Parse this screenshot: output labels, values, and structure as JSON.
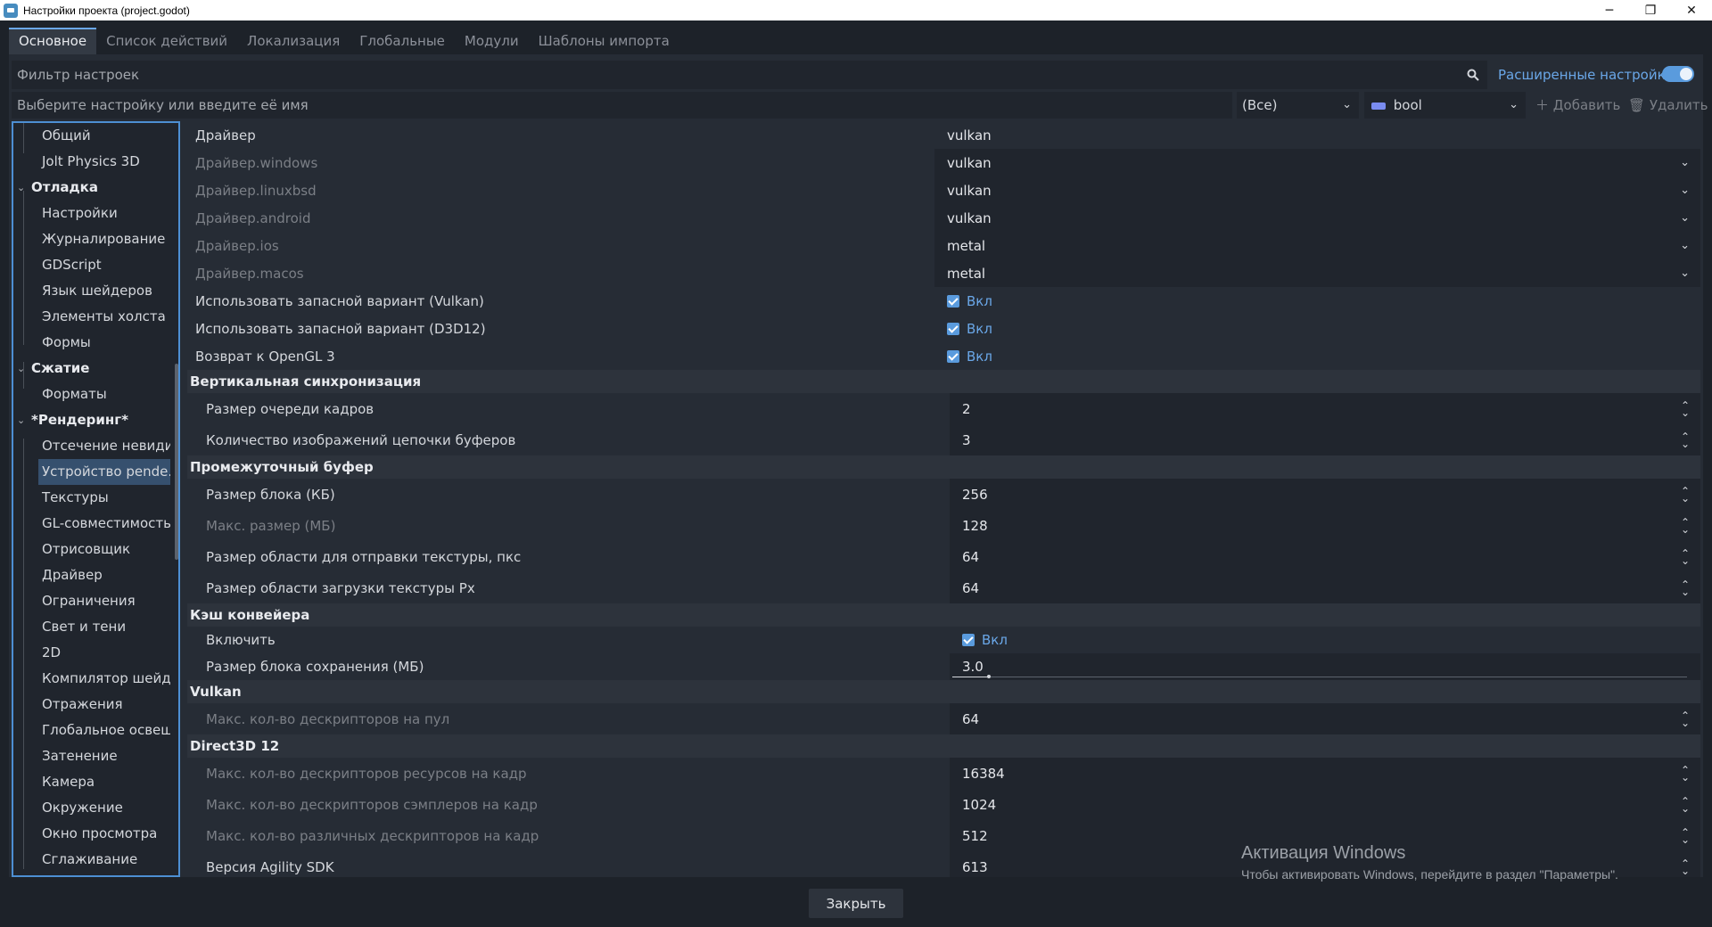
{
  "window": {
    "title": "Настройки проекта (project.godot)",
    "minimize": "─",
    "maximize": "❐",
    "close": "✕"
  },
  "tabs": [
    {
      "label": "Основное",
      "active": true
    },
    {
      "label": "Список действий"
    },
    {
      "label": "Локализация"
    },
    {
      "label": "Глобальные"
    },
    {
      "label": "Модули"
    },
    {
      "label": "Шаблоны импорта"
    }
  ],
  "filter": {
    "placeholder": "Фильтр настроек",
    "advanced_label": "Расширенные настройки",
    "advanced_on": true
  },
  "add_row": {
    "name_placeholder": "Выберите настройку или введите её имя",
    "type_filter": "(Все)",
    "value_type": "bool",
    "add_label": "Добавить",
    "delete_label": "Удалить"
  },
  "tree": [
    {
      "label": "Общий",
      "kind": "child"
    },
    {
      "label": "Jolt Physics 3D",
      "kind": "child"
    },
    {
      "label": "Отладка",
      "kind": "group"
    },
    {
      "label": "Настройки",
      "kind": "child"
    },
    {
      "label": "Журналирование ...",
      "kind": "child"
    },
    {
      "label": "GDScript",
      "kind": "child"
    },
    {
      "label": "Язык шейдеров",
      "kind": "child"
    },
    {
      "label": "Элементы холста",
      "kind": "child"
    },
    {
      "label": "Формы",
      "kind": "child"
    },
    {
      "label": "Сжатие",
      "kind": "group"
    },
    {
      "label": "Форматы",
      "kind": "child"
    },
    {
      "label": "*Рендеринг*",
      "kind": "group"
    },
    {
      "label": "Отсечение невиди...",
      "kind": "child"
    },
    {
      "label": "Устройство рende...",
      "kind": "child",
      "selected": true
    },
    {
      "label": "Текстуры",
      "kind": "child"
    },
    {
      "label": "GL-совместимость",
      "kind": "child"
    },
    {
      "label": "Отрисовщик",
      "kind": "child"
    },
    {
      "label": "Драйвер",
      "kind": "child"
    },
    {
      "label": "Ограничения",
      "kind": "child"
    },
    {
      "label": "Свет и тени",
      "kind": "child"
    },
    {
      "label": "2D",
      "kind": "child"
    },
    {
      "label": "Компилятор шейд...",
      "kind": "child"
    },
    {
      "label": "Отражения",
      "kind": "child"
    },
    {
      "label": "Глобальное освещ...",
      "kind": "child"
    },
    {
      "label": "Затенение",
      "kind": "child"
    },
    {
      "label": "Камера",
      "kind": "child"
    },
    {
      "label": "Окружение",
      "kind": "child"
    },
    {
      "label": "Окно просмотра",
      "kind": "child"
    },
    {
      "label": "Сглаживание",
      "kind": "child"
    }
  ],
  "settings": {
    "driver": {
      "rows": [
        {
          "label": "Драйвер",
          "value": "vulkan",
          "dim": false,
          "control": "text"
        },
        {
          "label": "Драйвер.windows",
          "value": "vulkan",
          "dim": true,
          "control": "dropdown"
        },
        {
          "label": "Драйвер.linuxbsd",
          "value": "vulkan",
          "dim": true,
          "control": "dropdown"
        },
        {
          "label": "Драйвер.android",
          "value": "vulkan",
          "dim": true,
          "control": "dropdown"
        },
        {
          "label": "Драйвер.ios",
          "value": "metal",
          "dim": true,
          "control": "dropdown"
        },
        {
          "label": "Драйвер.macos",
          "value": "metal",
          "dim": true,
          "control": "dropdown"
        },
        {
          "label": "Использовать запасной вариант (Vulkan)",
          "value": "Вкл",
          "dim": false,
          "control": "checkbox"
        },
        {
          "label": "Использовать запасной вариант (D3D12)",
          "value": "Вкл",
          "dim": false,
          "control": "checkbox"
        },
        {
          "label": "Возврат к OpenGL 3",
          "value": "Вкл",
          "dim": false,
          "control": "checkbox"
        }
      ]
    },
    "sections": [
      {
        "title": "Вертикальная синхронизация",
        "rows": [
          {
            "label": "Размер очереди кадров",
            "value": "2",
            "dim": false,
            "control": "spin"
          },
          {
            "label": "Количество изображений цепочки буферов",
            "value": "3",
            "dim": false,
            "control": "spin"
          }
        ]
      },
      {
        "title": "Промежуточный буфер",
        "rows": [
          {
            "label": "Размер блока (КБ)",
            "value": "256",
            "dim": false,
            "control": "spin"
          },
          {
            "label": "Макс. размер (МБ)",
            "value": "128",
            "dim": true,
            "control": "spin"
          },
          {
            "label": "Размер области для отправки текстуры, пкс",
            "value": "64",
            "dim": false,
            "control": "spin"
          },
          {
            "label": "Размер области загрузки текстуры Px",
            "value": "64",
            "dim": false,
            "control": "spin"
          }
        ]
      },
      {
        "title": "Кэш конвейера",
        "rows": [
          {
            "label": "Включить",
            "value": "Вкл",
            "dim": false,
            "control": "checkbox"
          },
          {
            "label": "Размер блока сохранения (МБ)",
            "value": "3.0",
            "dim": false,
            "control": "slider",
            "level": 0.05
          }
        ]
      },
      {
        "title": "Vulkan",
        "rows": [
          {
            "label": "Макс. кол-во дескрипторов на пул",
            "value": "64",
            "dim": true,
            "control": "spin"
          }
        ]
      },
      {
        "title": "Direct3D 12",
        "rows": [
          {
            "label": "Макс. кол-во дескрипторов ресурсов на кадр",
            "value": "16384",
            "dim": true,
            "control": "spin"
          },
          {
            "label": "Макс. кол-во дескрипторов сэмплеров на кадр",
            "value": "1024",
            "dim": true,
            "control": "spin"
          },
          {
            "label": "Макс. кол-во различных дескрипторов на кадр",
            "value": "512",
            "dim": true,
            "control": "spin"
          },
          {
            "label": "Версия Agility SDK",
            "value": "613",
            "dim": false,
            "control": "spin"
          }
        ]
      }
    ]
  },
  "watermark": {
    "line1": "Активация Windows",
    "line2": "Чтобы активировать Windows, перейдите в раздел \"Параметры\"."
  },
  "close_button": "Закрыть",
  "colors": {
    "accent": "#5a9bdd",
    "background": "#1d2229",
    "panel": "#262c35"
  }
}
